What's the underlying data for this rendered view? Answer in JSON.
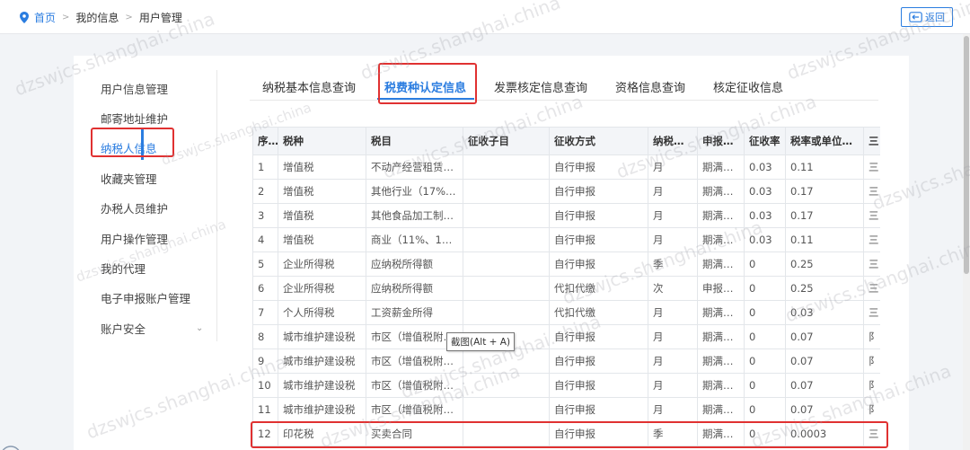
{
  "breadcrumb": {
    "home": "首页",
    "level2": "我的信息",
    "level3": "用户管理"
  },
  "back_button": "返回",
  "side_nav": [
    "用户信息管理",
    "邮寄地址维护",
    "纳税人信息",
    "收藏夹管理",
    "办税人员维护",
    "用户操作管理",
    "我的代理",
    "电子申报账户管理",
    "账户安全"
  ],
  "side_nav_active_index": 2,
  "tabs": [
    "纳税基本信息查询",
    "税费种认定信息",
    "发票核定信息查询",
    "资格信息查询",
    "核定征收信息"
  ],
  "tabs_active_index": 1,
  "table": {
    "headers": [
      "序号",
      "税种",
      "税目",
      "征收子目",
      "征收方式",
      "纳税期限",
      "申报期限",
      "征收率",
      "税率或单位税额",
      "三"
    ],
    "rows": [
      [
        "1",
        "增值税",
        "不动产经营租赁…",
        "",
        "自行申报",
        "月",
        "期满…",
        "0.03",
        "0.11",
        "三"
      ],
      [
        "2",
        "增值税",
        "其他行业（17%…",
        "",
        "自行申报",
        "月",
        "期满…",
        "0.03",
        "0.17",
        "三"
      ],
      [
        "3",
        "增值税",
        "其他食品加工制…",
        "",
        "自行申报",
        "月",
        "期满…",
        "0.03",
        "0.17",
        "三"
      ],
      [
        "4",
        "增值税",
        "商业（11%、10…",
        "",
        "自行申报",
        "月",
        "期满…",
        "0.03",
        "0.11",
        "三"
      ],
      [
        "5",
        "企业所得税",
        "应纳税所得额",
        "",
        "自行申报",
        "季",
        "期满…",
        "0",
        "0.25",
        "三"
      ],
      [
        "6",
        "企业所得税",
        "应纳税所得额",
        "",
        "代扣代缴",
        "次",
        "申报…",
        "0",
        "0.25",
        "三"
      ],
      [
        "7",
        "个人所得税",
        "工资薪金所得",
        "",
        "代扣代缴",
        "月",
        "期满…",
        "0",
        "0.03",
        "三"
      ],
      [
        "8",
        "城市维护建设税",
        "市区（增值税附…",
        "",
        "自行申报",
        "月",
        "期满…",
        "0",
        "0.07",
        "阝"
      ],
      [
        "9",
        "城市维护建设税",
        "市区（增值税附…",
        "",
        "自行申报",
        "月",
        "期满…",
        "0",
        "0.07",
        "阝"
      ],
      [
        "10",
        "城市维护建设税",
        "市区（增值税附…",
        "",
        "自行申报",
        "月",
        "期满…",
        "0",
        "0.07",
        "阝"
      ],
      [
        "11",
        "城市维护建设税",
        "市区（增值税附…",
        "",
        "自行申报",
        "月",
        "期满…",
        "0",
        "0.07",
        "阝"
      ],
      [
        "12",
        "印花税",
        "买卖合同",
        "",
        "自行申报",
        "季",
        "期满…",
        "0",
        "0.0003",
        "三"
      ]
    ]
  },
  "tooltip": "截图(Alt + A)",
  "watermark": "dzswjcs.shanghai.china",
  "colors": {
    "accent": "#2b7de0",
    "highlight": "#e03131"
  }
}
